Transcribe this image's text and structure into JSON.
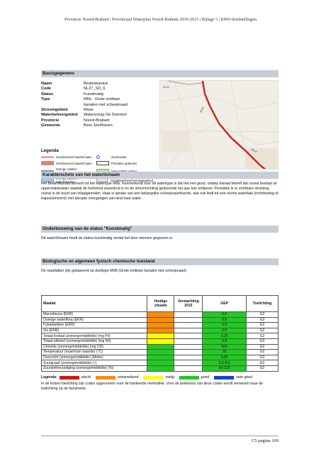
{
  "header": {
    "text": "Provincie Noord-Brabant | Provinciaal Waterplan Noord-Brabant 2010-2015 | Bijlage 5 | KRW-doelstellingen"
  },
  "basis": {
    "title": "Basisgegevens",
    "rows": [
      {
        "k": "Naam",
        "v": "Beatrixkanaal"
      },
      {
        "k": "Code",
        "v": "NL27_SD_6"
      },
      {
        "k": "Status",
        "v": "Kunstmatig"
      },
      {
        "k": "Type",
        "v": "M6b - Grote ondiepe kanalen met scheepvaart"
      },
      {
        "k": "Stroomgebied",
        "v": "Maas"
      },
      {
        "k": "Waterbeheergebied",
        "v": "Waterschap De Dommel"
      },
      {
        "k": "Provincie",
        "v": "Noord-Brabant"
      },
      {
        "k": "Gemeente",
        "v": "Best, Eindhoven"
      }
    ]
  },
  "map": {
    "labels": [
      "8020",
      "8020",
      "8018"
    ]
  },
  "legend": {
    "title": "Legenda",
    "items": [
      {
        "label": "Geselecteerd waterlichaam",
        "color": "#cc2222",
        "kind": "line"
      },
      {
        "label": "Zwemwater",
        "color": "#2255ee",
        "kind": "circle"
      },
      {
        "label": "Geselecteerd waterlichaam",
        "color": "#ff7a5a",
        "kind": "fill"
      },
      {
        "label": "Prioritaire gebieden",
        "color": "#ffffff",
        "kind": "box"
      },
      {
        "label": "Overige vlakken waterlichamen",
        "color": "#7799cc",
        "kind": "line"
      },
      {
        "label": "Natura2000 gebied",
        "color": "#c7e0a8",
        "kind": "fill"
      },
      {
        "label": "Overige vlakken waterlichamen",
        "color": "#aac4e6",
        "kind": "fill"
      },
      {
        "label": "Grondwaterbeschermingsgebied",
        "color": "#e6e6e6",
        "kind": "fill"
      }
    ]
  },
  "karakter": {
    "title": "Karakterschets van het waterlichaam",
    "text": "Het Beatrixkanaal behoort tot het watertype M6b. Kenmerkend voor dit watertype is dat het een groot, ondiep kanaal betreft dat vooral bestaat uit oppervlaktewater waarbij de herkomst wisselend is en de stroomrichting gedurende het jaar kan omkeren. Periodiek is er zichtbare stroming, vooral in de buurt van inlaatgemalen. Vaak is sprake van een belangrijke scheepvaartfunctie, wat ook leidt tot een rechte waterbak (rechthoekig of trapeziumvorm) met abrupte overgangen van land naar water."
  },
  "onderbouwing": {
    "title": "Onderbouwing van de status \"Kunstmatig\"",
    "text": "Dit waterlichaam heeft de status kunstmatig omdat het door mensen gegraven is."
  },
  "biologisch": {
    "title": "Biologische en algemeen fysisch chemische toestand",
    "intro": "De maatlatten zijn gebaseerd op doeltype M6B (Grote ondiepe kanalen met scheepvaart)"
  },
  "table": {
    "headers": [
      "Maatlat",
      "Huidige situatie",
      "Verwachting 2015",
      "GEP",
      "Toelichting"
    ],
    "rows": [
      {
        "maatlat": "Macrofauna (EKR)",
        "huidig": "",
        "hcolor": "#ff8c00",
        "verw": "",
        "gep": "0,6",
        "toel": "G2"
      },
      {
        "maatlat": "Overige waterflora (EKR)",
        "huidig": "",
        "hcolor": "#ff8c00",
        "verw": "",
        "gep": "0,6",
        "toel": "G2"
      },
      {
        "maatlat": "Fytoplankton (EKR)",
        "huidig": "",
        "hcolor": "#ff8c00",
        "verw": "",
        "gep": "0,6",
        "toel": "G2"
      },
      {
        "maatlat": "Vis (EKR)",
        "huidig": "",
        "hcolor": "#ff8c00",
        "verw": "",
        "gep": "0,6",
        "toel": "G2"
      },
      {
        "maatlat": "Totaal fosfaat (zomergemiddelde) (mg P/l)",
        "huidig": "",
        "hcolor": "#ffff00",
        "verw": "",
        "gep": "0,25",
        "toel": "G2"
      },
      {
        "maatlat": "Totaal stikstof (zomergemiddelde) (mg N/l)",
        "huidig": "",
        "hcolor": "#ffff00",
        "verw": "",
        "gep": "3,8",
        "toel": "G2"
      },
      {
        "maatlat": "Chloride (zomergemiddelde) (mg Cl/l)",
        "huidig": "",
        "hcolor": "#1fcc1f",
        "verw": "",
        "gep": "300",
        "toel": "G2"
      },
      {
        "maatlat": "Temperatuur (maximum waarde) (°C)",
        "huidig": "",
        "hcolor": "#1fcc1f",
        "verw": "",
        "gep": "25",
        "toel": "G2"
      },
      {
        "maatlat": "Doorzicht (zomergemiddelde) (Meter)",
        "huidig": "",
        "hcolor": "#1fcc1f",
        "verw": "",
        "gep": "0,80",
        "toel": "G2"
      },
      {
        "maatlat": "Zuurgraad (zomergemiddelde) (-)",
        "huidig": "",
        "hcolor": "#1fcc1f",
        "verw": "",
        "gep": "5,5-8,5",
        "toel": "G2"
      },
      {
        "maatlat": "Zuurstofverzadiging (zomergemiddelde) (%)",
        "huidig": "",
        "hcolor": "#1fcc1f",
        "verw": "",
        "gep": "60-120",
        "toel": "G2"
      }
    ]
  },
  "score_legend": {
    "label": "Legenda:",
    "items": [
      {
        "label": "slecht",
        "color": "#dd1111"
      },
      {
        "label": "ontoereikend",
        "color": "#ff8c00"
      },
      {
        "label": "matig",
        "color": "#ffff00"
      },
      {
        "label": "goed",
        "color": "#1fcc1f"
      },
      {
        "label": "zeer goed",
        "color": "#1144dd"
      }
    ]
  },
  "note": "In de kolom toelichting zijn codes opgenomen voor de hanteerde methodiek. Voor de betekenis van deze codes wordt verwezen naar de toelichting op de factsheets.",
  "footer": {
    "page": "C5 pagina 169"
  }
}
